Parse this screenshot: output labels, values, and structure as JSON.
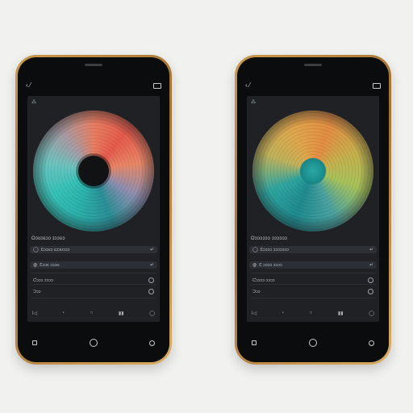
{
  "phones": [
    {
      "id": "left",
      "top_left_icon": "‹ ⁄",
      "screen_status": "⁂",
      "section_title": "Oɔʊɔɛɔɔ ɪɔɔʊɔ",
      "rows": [
        {
          "label": "Ɛɔɔʊɔ ɛɔɔʊɔɔɔ",
          "lead": "◯",
          "trail": "↵",
          "type": "field"
        },
        {
          "label": "Ɛɔɔɛ ɔɔɔʊ",
          "lead": "◍",
          "trail": "↵",
          "type": "field"
        },
        {
          "label": "Ƈɔɔɔ ɔɔɔɔ",
          "type": "toggle"
        },
        {
          "label": "Ɔɔɔ",
          "type": "toggle"
        }
      ],
      "controls": [
        "ǀ◁",
        "‹",
        "○",
        "▮▮",
        "◯"
      ],
      "disc_colors": {
        "primary": "#37c2b7",
        "secondary": "#e65a4c",
        "hub": "#111214"
      }
    },
    {
      "id": "right",
      "top_left_icon": "‹ ⁄",
      "screen_status": "⁂",
      "section_title": "Oɔɔɔɔɔɔ ɔɔɔɔɔɔ",
      "rows": [
        {
          "label": "Ɛɔɔɔɔ ɔɔɔɔɔɔɔ",
          "lead": "◯",
          "trail": "↵",
          "type": "field"
        },
        {
          "label": "Ɛ ɔɔɔɔ ɔɔɔɔ",
          "lead": "◍",
          "trail": "↵",
          "type": "field"
        },
        {
          "label": "Ƈɔɔɔɔ ɔɔɔɔ",
          "type": "toggle"
        },
        {
          "label": "Ɔɔɔ",
          "type": "toggle"
        }
      ],
      "controls": [
        "ǀ◁",
        "‹",
        "○",
        "▮▮",
        "◯"
      ],
      "disc_colors": {
        "primary": "#e0a64c",
        "secondary": "#2fa5a0",
        "hub": "#2aa8a4"
      }
    }
  ],
  "icons": {
    "battery": "battery-icon",
    "back": "back-icon",
    "home": "home-icon",
    "recents": "recents-icon"
  },
  "colors": {
    "frame_gold": "#b98540",
    "screen_bg": "#1f2124",
    "background": "#f1f1f0"
  }
}
